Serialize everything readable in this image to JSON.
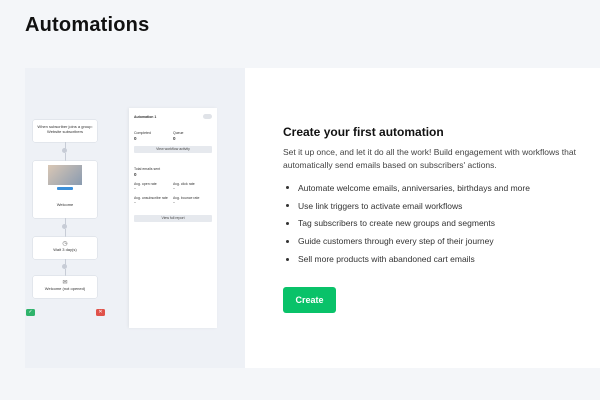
{
  "page": {
    "title": "Automations"
  },
  "workflow_preview": {
    "trigger_text": "When subscriber joins a group: Website subscribers",
    "email_node_label": "Welcome",
    "wait_label": "Wait 3 day(s)",
    "final_email_label": "Welcome (not opened)",
    "panel_title": "Automation 1",
    "completed_label": "Completed",
    "completed_value": "0",
    "queue_label": "Queue",
    "queue_value": "0",
    "view_activity_label": "View workflow activity",
    "total_emails_label": "Total emails sent",
    "total_emails_value": "0",
    "open_rate_label": "Avg. open rate",
    "open_rate_value": "–",
    "click_rate_label": "Avg. click rate",
    "click_rate_value": "–",
    "unsub_rate_label": "Avg. unsubscribe rate",
    "unsub_rate_value": "–",
    "bounce_rate_label": "Avg. bounce rate",
    "bounce_rate_value": "–",
    "view_report_label": "View full report",
    "colors": {
      "confirm": "#2fb36b",
      "cancel": "#e0524a"
    }
  },
  "main": {
    "heading": "Create your first automation",
    "description": "Set it up once, and let it do all the work! Build engagement with workflows that automatically send emails based on subscribers' actions.",
    "features": [
      "Automate welcome emails, anniversaries, birthdays and more",
      "Use link triggers to activate email workflows",
      "Tag subscribers to create new groups and segments",
      "Guide customers through every step of their journey",
      "Sell more products with abandoned cart emails"
    ],
    "create_label": "Create",
    "accent": "#09c269"
  }
}
